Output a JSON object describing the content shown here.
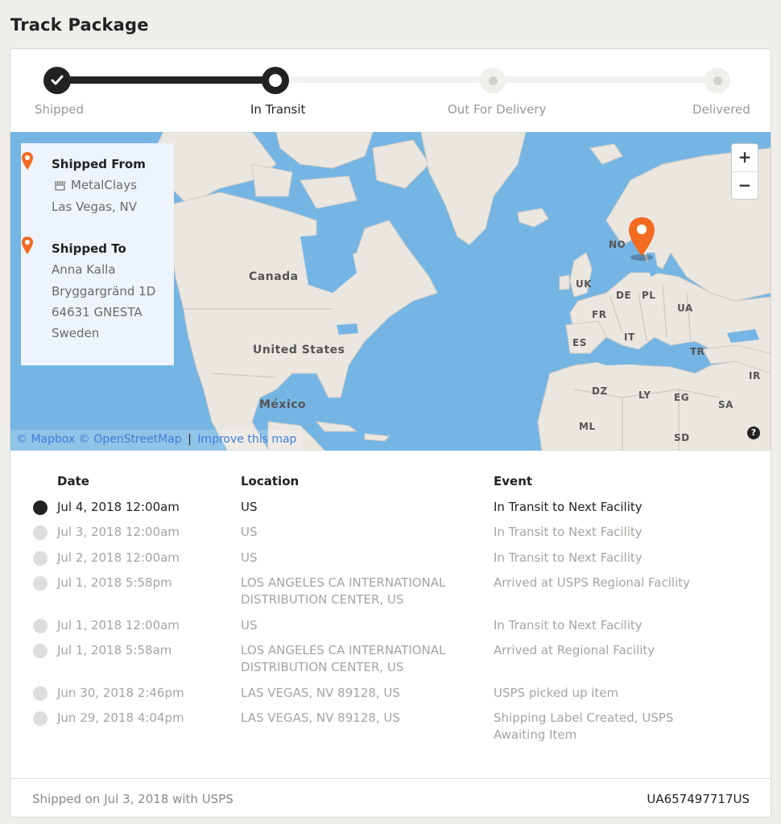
{
  "page": {
    "title": "Track Package"
  },
  "progress": {
    "steps": [
      {
        "label": "Shipped",
        "state": "done"
      },
      {
        "label": "In Transit",
        "state": "current"
      },
      {
        "label": "Out For Delivery",
        "state": "future"
      },
      {
        "label": "Delivered",
        "state": "future"
      }
    ]
  },
  "map": {
    "shipped_from": {
      "heading": "Shipped From",
      "store_icon": "store-icon",
      "store": "MetalClays",
      "city": "Las Vegas, NV"
    },
    "shipped_to": {
      "heading": "Shipped To",
      "name": "Anna Kalla",
      "street": "Bryggargränd 1D",
      "postal": "64631 GNESTA",
      "country": "Sweden"
    },
    "zoom_in": "+",
    "zoom_out": "−",
    "labels": {
      "canada": "Canada",
      "us": "United States",
      "mexico": "México",
      "no": "NO",
      "uk": "UK",
      "de": "DE",
      "pl": "PL",
      "fr": "FR",
      "ua": "UA",
      "es": "ES",
      "it": "IT",
      "tr": "TR",
      "ir": "IR",
      "dz": "DZ",
      "ly": "LY",
      "eg": "EG",
      "sa": "SA",
      "ml": "ML",
      "sd": "SD"
    },
    "attribution": {
      "mapbox": "© Mapbox",
      "osm": "© OpenStreetMap",
      "separator": "|",
      "improve": "Improve this map"
    },
    "help": "?",
    "colors": {
      "water": "#75b5e3",
      "land": "#eae6e0",
      "pin": "#f26b21"
    }
  },
  "table": {
    "headers": {
      "date": "Date",
      "location": "Location",
      "event": "Event"
    },
    "rows": [
      {
        "date": "Jul 4, 2018 12:00am",
        "location": "US",
        "event": "In Transit to Next Facility",
        "active": true
      },
      {
        "date": "Jul 3, 2018 12:00am",
        "location": "US",
        "event": "In Transit to Next Facility",
        "active": false
      },
      {
        "date": "Jul 2, 2018 12:00am",
        "location": "US",
        "event": "In Transit to Next Facility",
        "active": false
      },
      {
        "date": "Jul 1, 2018 5:58pm",
        "location": "LOS ANGELES CA INTERNATIONAL DISTRIBUTION CENTER, US",
        "event": "Arrived at USPS Regional Facility",
        "active": false
      },
      {
        "date": "Jul 1, 2018 12:00am",
        "location": "US",
        "event": "In Transit to Next Facility",
        "active": false
      },
      {
        "date": "Jul 1, 2018 5:58am",
        "location": "LOS ANGELES CA INTERNATIONAL DISTRIBUTION CENTER, US",
        "event": "Arrived at Regional Facility",
        "active": false
      },
      {
        "date": "Jun 30, 2018 2:46pm",
        "location": "LAS VEGAS, NV 89128, US",
        "event": "USPS picked up item",
        "active": false
      },
      {
        "date": "Jun 29, 2018 4:04pm",
        "location": "LAS VEGAS, NV 89128, US",
        "event": "Shipping Label Created, USPS Awaiting Item",
        "active": false
      }
    ]
  },
  "footer": {
    "shipped_on": "Shipped on Jul 3, 2018 with USPS",
    "tracking_number": "UA657497717US"
  }
}
